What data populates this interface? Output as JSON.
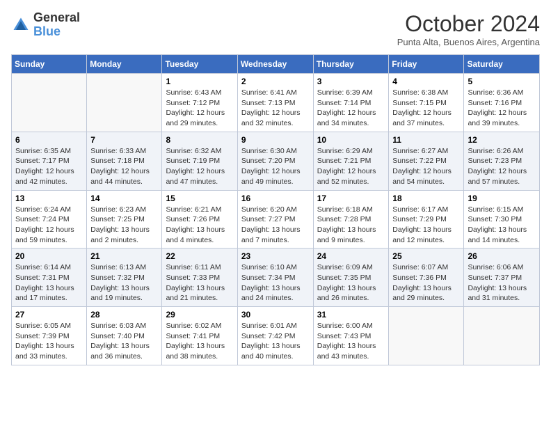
{
  "header": {
    "logo_general": "General",
    "logo_blue": "Blue",
    "month_title": "October 2024",
    "location": "Punta Alta, Buenos Aires, Argentina"
  },
  "days_of_week": [
    "Sunday",
    "Monday",
    "Tuesday",
    "Wednesday",
    "Thursday",
    "Friday",
    "Saturday"
  ],
  "weeks": [
    [
      {
        "day": "",
        "info": ""
      },
      {
        "day": "",
        "info": ""
      },
      {
        "day": "1",
        "info": "Sunrise: 6:43 AM\nSunset: 7:12 PM\nDaylight: 12 hours and 29 minutes."
      },
      {
        "day": "2",
        "info": "Sunrise: 6:41 AM\nSunset: 7:13 PM\nDaylight: 12 hours and 32 minutes."
      },
      {
        "day": "3",
        "info": "Sunrise: 6:39 AM\nSunset: 7:14 PM\nDaylight: 12 hours and 34 minutes."
      },
      {
        "day": "4",
        "info": "Sunrise: 6:38 AM\nSunset: 7:15 PM\nDaylight: 12 hours and 37 minutes."
      },
      {
        "day": "5",
        "info": "Sunrise: 6:36 AM\nSunset: 7:16 PM\nDaylight: 12 hours and 39 minutes."
      }
    ],
    [
      {
        "day": "6",
        "info": "Sunrise: 6:35 AM\nSunset: 7:17 PM\nDaylight: 12 hours and 42 minutes."
      },
      {
        "day": "7",
        "info": "Sunrise: 6:33 AM\nSunset: 7:18 PM\nDaylight: 12 hours and 44 minutes."
      },
      {
        "day": "8",
        "info": "Sunrise: 6:32 AM\nSunset: 7:19 PM\nDaylight: 12 hours and 47 minutes."
      },
      {
        "day": "9",
        "info": "Sunrise: 6:30 AM\nSunset: 7:20 PM\nDaylight: 12 hours and 49 minutes."
      },
      {
        "day": "10",
        "info": "Sunrise: 6:29 AM\nSunset: 7:21 PM\nDaylight: 12 hours and 52 minutes."
      },
      {
        "day": "11",
        "info": "Sunrise: 6:27 AM\nSunset: 7:22 PM\nDaylight: 12 hours and 54 minutes."
      },
      {
        "day": "12",
        "info": "Sunrise: 6:26 AM\nSunset: 7:23 PM\nDaylight: 12 hours and 57 minutes."
      }
    ],
    [
      {
        "day": "13",
        "info": "Sunrise: 6:24 AM\nSunset: 7:24 PM\nDaylight: 12 hours and 59 minutes."
      },
      {
        "day": "14",
        "info": "Sunrise: 6:23 AM\nSunset: 7:25 PM\nDaylight: 13 hours and 2 minutes."
      },
      {
        "day": "15",
        "info": "Sunrise: 6:21 AM\nSunset: 7:26 PM\nDaylight: 13 hours and 4 minutes."
      },
      {
        "day": "16",
        "info": "Sunrise: 6:20 AM\nSunset: 7:27 PM\nDaylight: 13 hours and 7 minutes."
      },
      {
        "day": "17",
        "info": "Sunrise: 6:18 AM\nSunset: 7:28 PM\nDaylight: 13 hours and 9 minutes."
      },
      {
        "day": "18",
        "info": "Sunrise: 6:17 AM\nSunset: 7:29 PM\nDaylight: 13 hours and 12 minutes."
      },
      {
        "day": "19",
        "info": "Sunrise: 6:15 AM\nSunset: 7:30 PM\nDaylight: 13 hours and 14 minutes."
      }
    ],
    [
      {
        "day": "20",
        "info": "Sunrise: 6:14 AM\nSunset: 7:31 PM\nDaylight: 13 hours and 17 minutes."
      },
      {
        "day": "21",
        "info": "Sunrise: 6:13 AM\nSunset: 7:32 PM\nDaylight: 13 hours and 19 minutes."
      },
      {
        "day": "22",
        "info": "Sunrise: 6:11 AM\nSunset: 7:33 PM\nDaylight: 13 hours and 21 minutes."
      },
      {
        "day": "23",
        "info": "Sunrise: 6:10 AM\nSunset: 7:34 PM\nDaylight: 13 hours and 24 minutes."
      },
      {
        "day": "24",
        "info": "Sunrise: 6:09 AM\nSunset: 7:35 PM\nDaylight: 13 hours and 26 minutes."
      },
      {
        "day": "25",
        "info": "Sunrise: 6:07 AM\nSunset: 7:36 PM\nDaylight: 13 hours and 29 minutes."
      },
      {
        "day": "26",
        "info": "Sunrise: 6:06 AM\nSunset: 7:37 PM\nDaylight: 13 hours and 31 minutes."
      }
    ],
    [
      {
        "day": "27",
        "info": "Sunrise: 6:05 AM\nSunset: 7:39 PM\nDaylight: 13 hours and 33 minutes."
      },
      {
        "day": "28",
        "info": "Sunrise: 6:03 AM\nSunset: 7:40 PM\nDaylight: 13 hours and 36 minutes."
      },
      {
        "day": "29",
        "info": "Sunrise: 6:02 AM\nSunset: 7:41 PM\nDaylight: 13 hours and 38 minutes."
      },
      {
        "day": "30",
        "info": "Sunrise: 6:01 AM\nSunset: 7:42 PM\nDaylight: 13 hours and 40 minutes."
      },
      {
        "day": "31",
        "info": "Sunrise: 6:00 AM\nSunset: 7:43 PM\nDaylight: 13 hours and 43 minutes."
      },
      {
        "day": "",
        "info": ""
      },
      {
        "day": "",
        "info": ""
      }
    ]
  ]
}
